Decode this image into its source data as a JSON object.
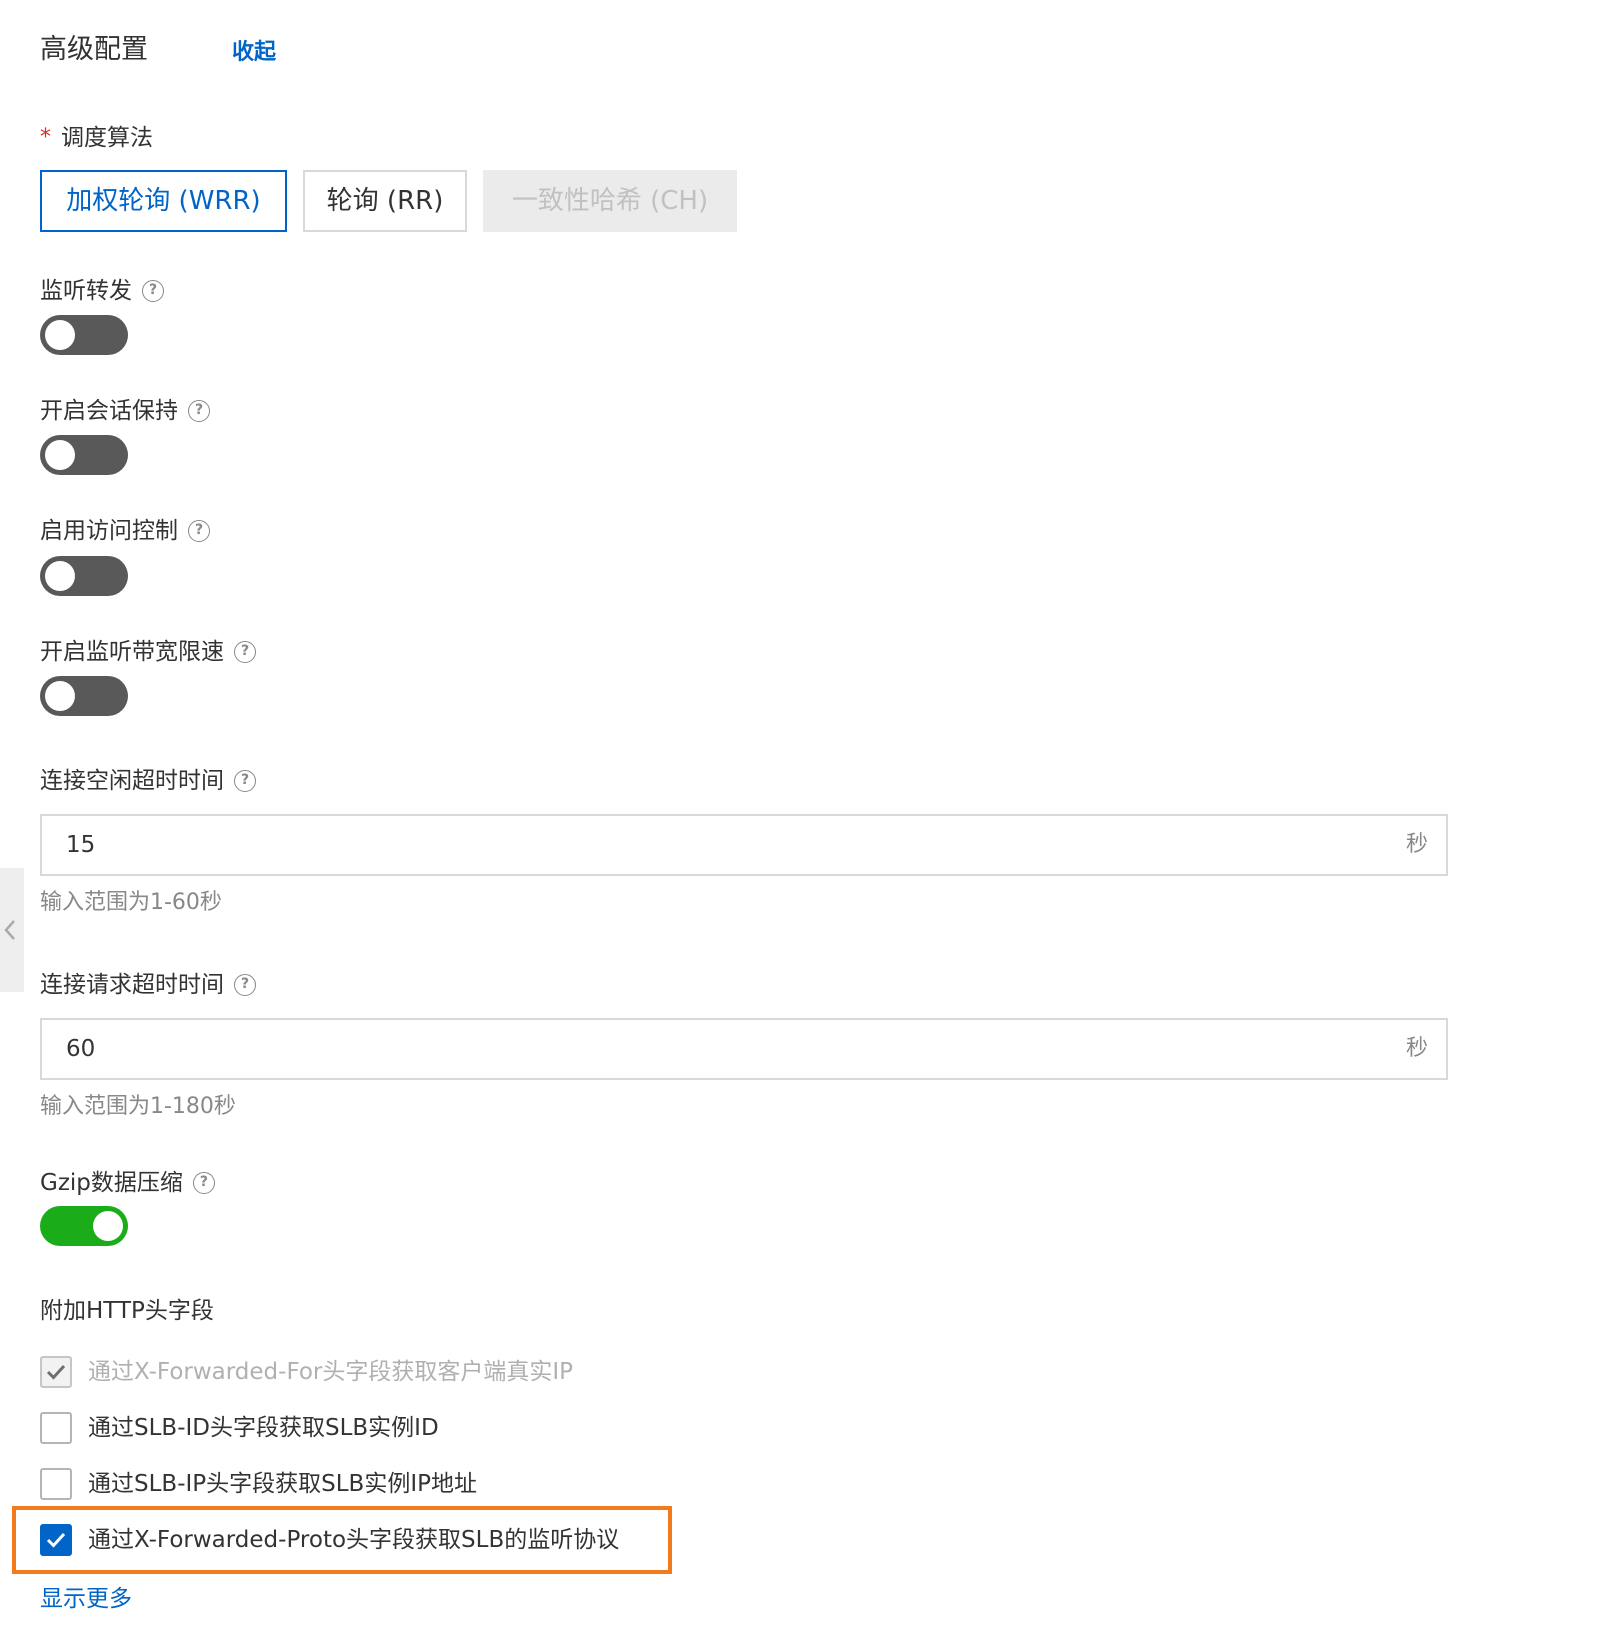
{
  "header": {
    "title": "高级配置",
    "collapse_label": "收起"
  },
  "scheduler": {
    "required_mark": "*",
    "label": "调度算法",
    "options": [
      {
        "label": "加权轮询 (WRR)",
        "state": "selected"
      },
      {
        "label": "轮询 (RR)",
        "state": "normal"
      },
      {
        "label": "一致性哈希 (CH)",
        "state": "disabled"
      }
    ]
  },
  "help_glyph": "?",
  "toggles": [
    {
      "label": "监听转发",
      "on": false
    },
    {
      "label": "开启会话保持",
      "on": false
    },
    {
      "label": "启用访问控制",
      "on": false
    },
    {
      "label": "开启监听带宽限速",
      "on": false
    }
  ],
  "idle_timeout": {
    "label": "连接空闲超时时间",
    "value": "15",
    "unit": "秒",
    "hint": "输入范围为1-60秒"
  },
  "request_timeout": {
    "label": "连接请求超时时间",
    "value": "60",
    "unit": "秒",
    "hint": "输入范围为1-180秒"
  },
  "gzip": {
    "label": "Gzip数据压缩",
    "on": true
  },
  "http_headers": {
    "label": "附加HTTP头字段",
    "items": [
      {
        "label": "通过X-Forwarded-For头字段获取客户端真实IP",
        "checked": true,
        "disabled": true
      },
      {
        "label": "通过SLB-ID头字段获取SLB实例ID",
        "checked": false,
        "disabled": false
      },
      {
        "label": "通过SLB-IP头字段获取SLB实例IP地址",
        "checked": false,
        "disabled": false
      },
      {
        "label": "通过X-Forwarded-Proto头字段获取SLB的监听协议",
        "checked": true,
        "disabled": false
      }
    ]
  },
  "show_more_label": "显示更多",
  "colors": {
    "primary": "#0064c8",
    "switch_on": "#1aad19",
    "switch_off": "#595959",
    "highlight": "#f27b1d",
    "required": "#d93026"
  }
}
